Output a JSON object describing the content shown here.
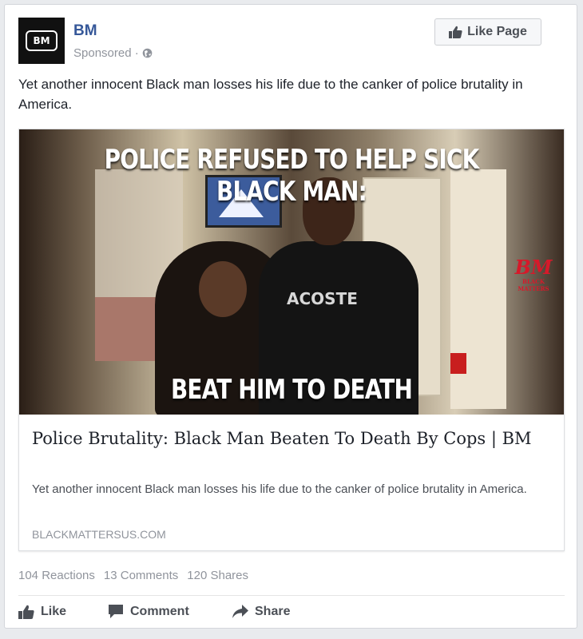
{
  "post": {
    "page_name": "BM",
    "avatar_text": "BM",
    "sponsored": "Sponsored ·",
    "like_page_label": "Like Page",
    "text": "Yet another innocent Black man losses his life due to the canker of police brutality in America."
  },
  "link": {
    "image_headline_top": "POLICE REFUSED TO HELP SICK BLACK MAN:",
    "image_headline_bottom": "BEAT HIM TO DEATH",
    "image_shirt_text": "ACOSTE",
    "watermark_big": "BM",
    "watermark_small": "BLACK MATTERS",
    "title": "Police Brutality: Black Man Beaten To Death By Cops | BM",
    "description": "Yet another innocent Black man losses his life due to the canker of police brutality in America.",
    "domain": "BLACKMATTERSUS.COM"
  },
  "stats": {
    "reactions": "104 Reactions",
    "comments": "13 Comments",
    "shares": "120 Shares"
  },
  "actions": {
    "like": "Like",
    "comment": "Comment",
    "share": "Share"
  },
  "colors": {
    "page_name": "#365899",
    "watermark": "#d6192a"
  },
  "icons": {
    "avatar": "us-map-logo-icon",
    "privacy": "globe-icon",
    "like_page": "thumbs-up-icon",
    "like": "thumbs-up-icon",
    "comment": "speech-bubble-icon",
    "share": "share-arrow-icon"
  }
}
